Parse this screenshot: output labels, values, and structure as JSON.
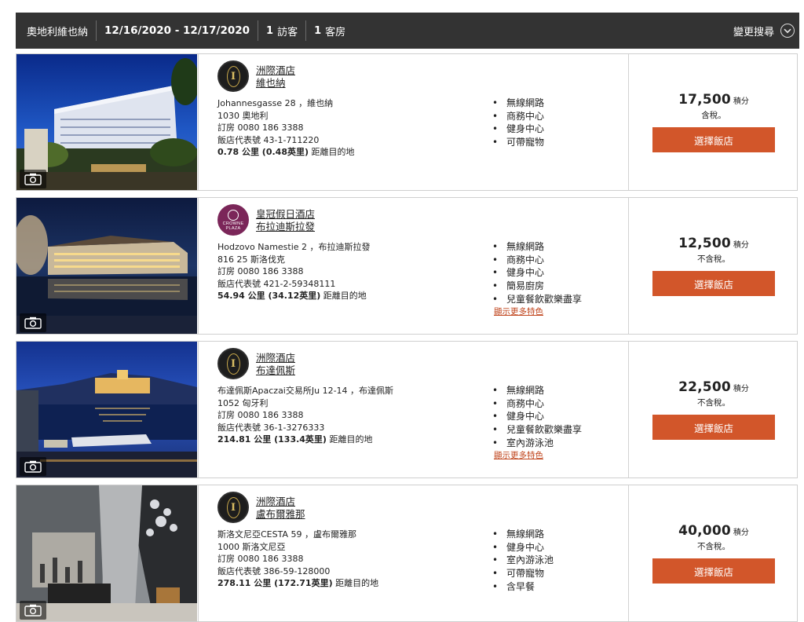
{
  "search": {
    "location": "奧地利維也納",
    "dates": "12/16/2020 - 12/17/2020",
    "guests_num": "1",
    "guests_label": "訪客",
    "rooms_num": "1",
    "rooms_label": "客房",
    "change_label": "變更搜尋",
    "change_icon": "chevron-down-icon"
  },
  "colors": {
    "header_bg": "#333333",
    "select_button": "#d2562a",
    "more_link": "#c0451d",
    "crowne_plaza_logo": "#7b2659"
  },
  "hotels": [
    {
      "brand": "洲際酒店",
      "city": "維也納",
      "logo": "intercontinental-logo",
      "address1": "Johannesgasse 28 ，維也納",
      "address2": "1030 奧地利",
      "phone": "訂房 0080 186 3388",
      "hotel_phone": "飯店代表號 43-1-711220",
      "distance": "0.78 公里 (0.48英里)",
      "distance_suffix": " 距離目的地",
      "amenities": [
        "無線網路",
        "商務中心",
        "健身中心",
        "可帶寵物"
      ],
      "more_link": "",
      "points": "17,500",
      "points_label": "積分",
      "tax": "含稅。",
      "select_label": "選擇飯店"
    },
    {
      "brand": "皇冠假日酒店",
      "city": "布拉迪斯拉發",
      "logo": "crowne-plaza-logo",
      "logo_text1": "CROWNE",
      "logo_text2": "PLAZA",
      "address1": "Hodzovo Namestie 2 ，布拉迪斯拉發",
      "address2": "816 25 斯洛伐克",
      "phone": "訂房 0080 186 3388",
      "hotel_phone": "飯店代表號 421-2-59348111",
      "distance": "54.94 公里 (34.12英里)",
      "distance_suffix": " 距離目的地",
      "amenities": [
        "無線網路",
        "商務中心",
        "健身中心",
        "簡易廚房",
        "兒童餐飲歡樂盡享"
      ],
      "more_link": "顯示更多特色",
      "points": "12,500",
      "points_label": "積分",
      "tax": "不含稅。",
      "select_label": "選擇飯店"
    },
    {
      "brand": "洲際酒店",
      "city": "布達佩斯",
      "logo": "intercontinental-logo",
      "address1": "布達佩斯Apaczai交易所Ju 12-14 ，布達佩斯",
      "address2": "1052 匈牙利",
      "phone": "訂房 0080 186 3388",
      "hotel_phone": "飯店代表號 36-1-3276333",
      "distance": "214.81 公里 (133.4英里)",
      "distance_suffix": " 距離目的地",
      "amenities": [
        "無線網路",
        "商務中心",
        "健身中心",
        "兒童餐飲歡樂盡享",
        "室內游泳池"
      ],
      "more_link": "顯示更多特色",
      "points": "22,500",
      "points_label": "積分",
      "tax": "不含稅。",
      "select_label": "選擇飯店"
    },
    {
      "brand": "洲際酒店",
      "city": "盧布爾雅那",
      "logo": "intercontinental-logo",
      "address1": "斯洛文尼亞CESTA 59 ，盧布爾雅那",
      "address2": "1000 斯洛文尼亞",
      "phone": "訂房 0080 186 3388",
      "hotel_phone": "飯店代表號 386-59-128000",
      "distance": "278.11 公里 (172.71英里)",
      "distance_suffix": " 距離目的地",
      "amenities": [
        "無線網路",
        "健身中心",
        "室內游泳池",
        "可帶寵物",
        "含早餐"
      ],
      "more_link": "",
      "points": "40,000",
      "points_label": "積分",
      "tax": "不含稅。",
      "select_label": "選擇飯店"
    }
  ]
}
